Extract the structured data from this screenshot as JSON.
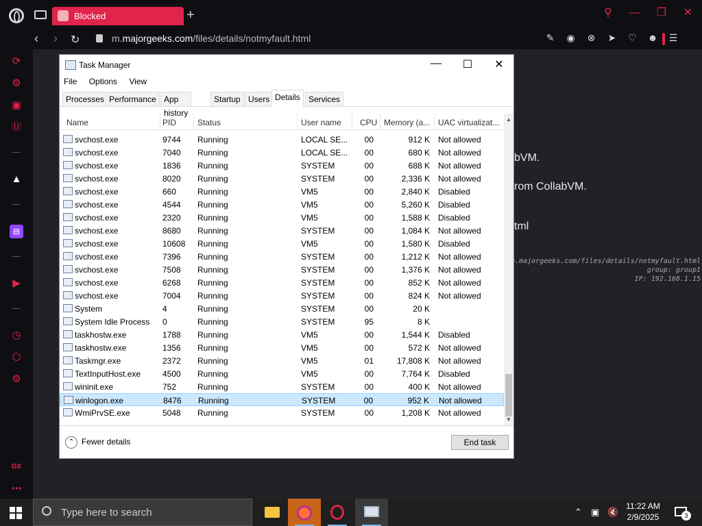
{
  "browser": {
    "tab_title": "Blocked",
    "url_prefix": "m.",
    "url_domain": "majorgeeks.com",
    "url_path": "/files/details/notmyfault.html"
  },
  "page": {
    "line1": "bVM.",
    "line2": "rom CollabVM.",
    "line3": "tml",
    "mono1": "m.majorgeeks.com/files/details/notmyfault.html",
    "mono2": "group: group1",
    "mono3": "IP: 192.168.1.15"
  },
  "sidebar": {
    "gx_label": "GX"
  },
  "taskmanager": {
    "title": "Task Manager",
    "menu": [
      "File",
      "Options",
      "View"
    ],
    "tabs": [
      "Processes",
      "Performance",
      "App history",
      "Startup",
      "Users",
      "Details",
      "Services"
    ],
    "active_tab": "Details",
    "columns": [
      "Name",
      "PID",
      "Status",
      "User name",
      "CPU",
      "Memory (a...",
      "UAC virtualizat..."
    ],
    "rows": [
      [
        "svchost.exe",
        "9744",
        "Running",
        "LOCAL SE...",
        "00",
        "912 K",
        "Not allowed"
      ],
      [
        "svchost.exe",
        "7040",
        "Running",
        "LOCAL SE...",
        "00",
        "680 K",
        "Not allowed"
      ],
      [
        "svchost.exe",
        "1836",
        "Running",
        "SYSTEM",
        "00",
        "688 K",
        "Not allowed"
      ],
      [
        "svchost.exe",
        "8020",
        "Running",
        "SYSTEM",
        "00",
        "2,336 K",
        "Not allowed"
      ],
      [
        "svchost.exe",
        "660",
        "Running",
        "VM5",
        "00",
        "2,840 K",
        "Disabled"
      ],
      [
        "svchost.exe",
        "4544",
        "Running",
        "VM5",
        "00",
        "5,260 K",
        "Disabled"
      ],
      [
        "svchost.exe",
        "2320",
        "Running",
        "VM5",
        "00",
        "1,588 K",
        "Disabled"
      ],
      [
        "svchost.exe",
        "8680",
        "Running",
        "SYSTEM",
        "00",
        "1,084 K",
        "Not allowed"
      ],
      [
        "svchost.exe",
        "10608",
        "Running",
        "VM5",
        "00",
        "1,580 K",
        "Disabled"
      ],
      [
        "svchost.exe",
        "7396",
        "Running",
        "SYSTEM",
        "00",
        "1,212 K",
        "Not allowed"
      ],
      [
        "svchost.exe",
        "7508",
        "Running",
        "SYSTEM",
        "00",
        "1,376 K",
        "Not allowed"
      ],
      [
        "svchost.exe",
        "6268",
        "Running",
        "SYSTEM",
        "00",
        "852 K",
        "Not allowed"
      ],
      [
        "svchost.exe",
        "7004",
        "Running",
        "SYSTEM",
        "00",
        "824 K",
        "Not allowed"
      ],
      [
        "System",
        "4",
        "Running",
        "SYSTEM",
        "00",
        "20 K",
        ""
      ],
      [
        "System Idle Process",
        "0",
        "Running",
        "SYSTEM",
        "95",
        "8 K",
        ""
      ],
      [
        "taskhostw.exe",
        "1788",
        "Running",
        "VM5",
        "00",
        "1,544 K",
        "Disabled"
      ],
      [
        "taskhostw.exe",
        "1356",
        "Running",
        "VM5",
        "00",
        "572 K",
        "Not allowed"
      ],
      [
        "Taskmgr.exe",
        "2372",
        "Running",
        "VM5",
        "01",
        "17,808 K",
        "Not allowed"
      ],
      [
        "TextInputHost.exe",
        "4500",
        "Running",
        "VM5",
        "00",
        "7,764 K",
        "Disabled"
      ],
      [
        "wininit.exe",
        "752",
        "Running",
        "SYSTEM",
        "00",
        "400 K",
        "Not allowed"
      ],
      [
        "winlogon.exe",
        "8476",
        "Running",
        "SYSTEM",
        "00",
        "952 K",
        "Not allowed"
      ],
      [
        "WmiPrvSE.exe",
        "5048",
        "Running",
        "SYSTEM",
        "00",
        "1,208 K",
        "Not allowed"
      ]
    ],
    "selected_row": 20,
    "fewer_details": "Fewer details",
    "end_task": "End task"
  },
  "taskbar": {
    "search_placeholder": "Type here to search",
    "time": "11:22 AM",
    "date": "2/9/2025",
    "notifications": "3"
  },
  "colors": {
    "accent": "#e0244a",
    "selection": "#cce8ff"
  }
}
